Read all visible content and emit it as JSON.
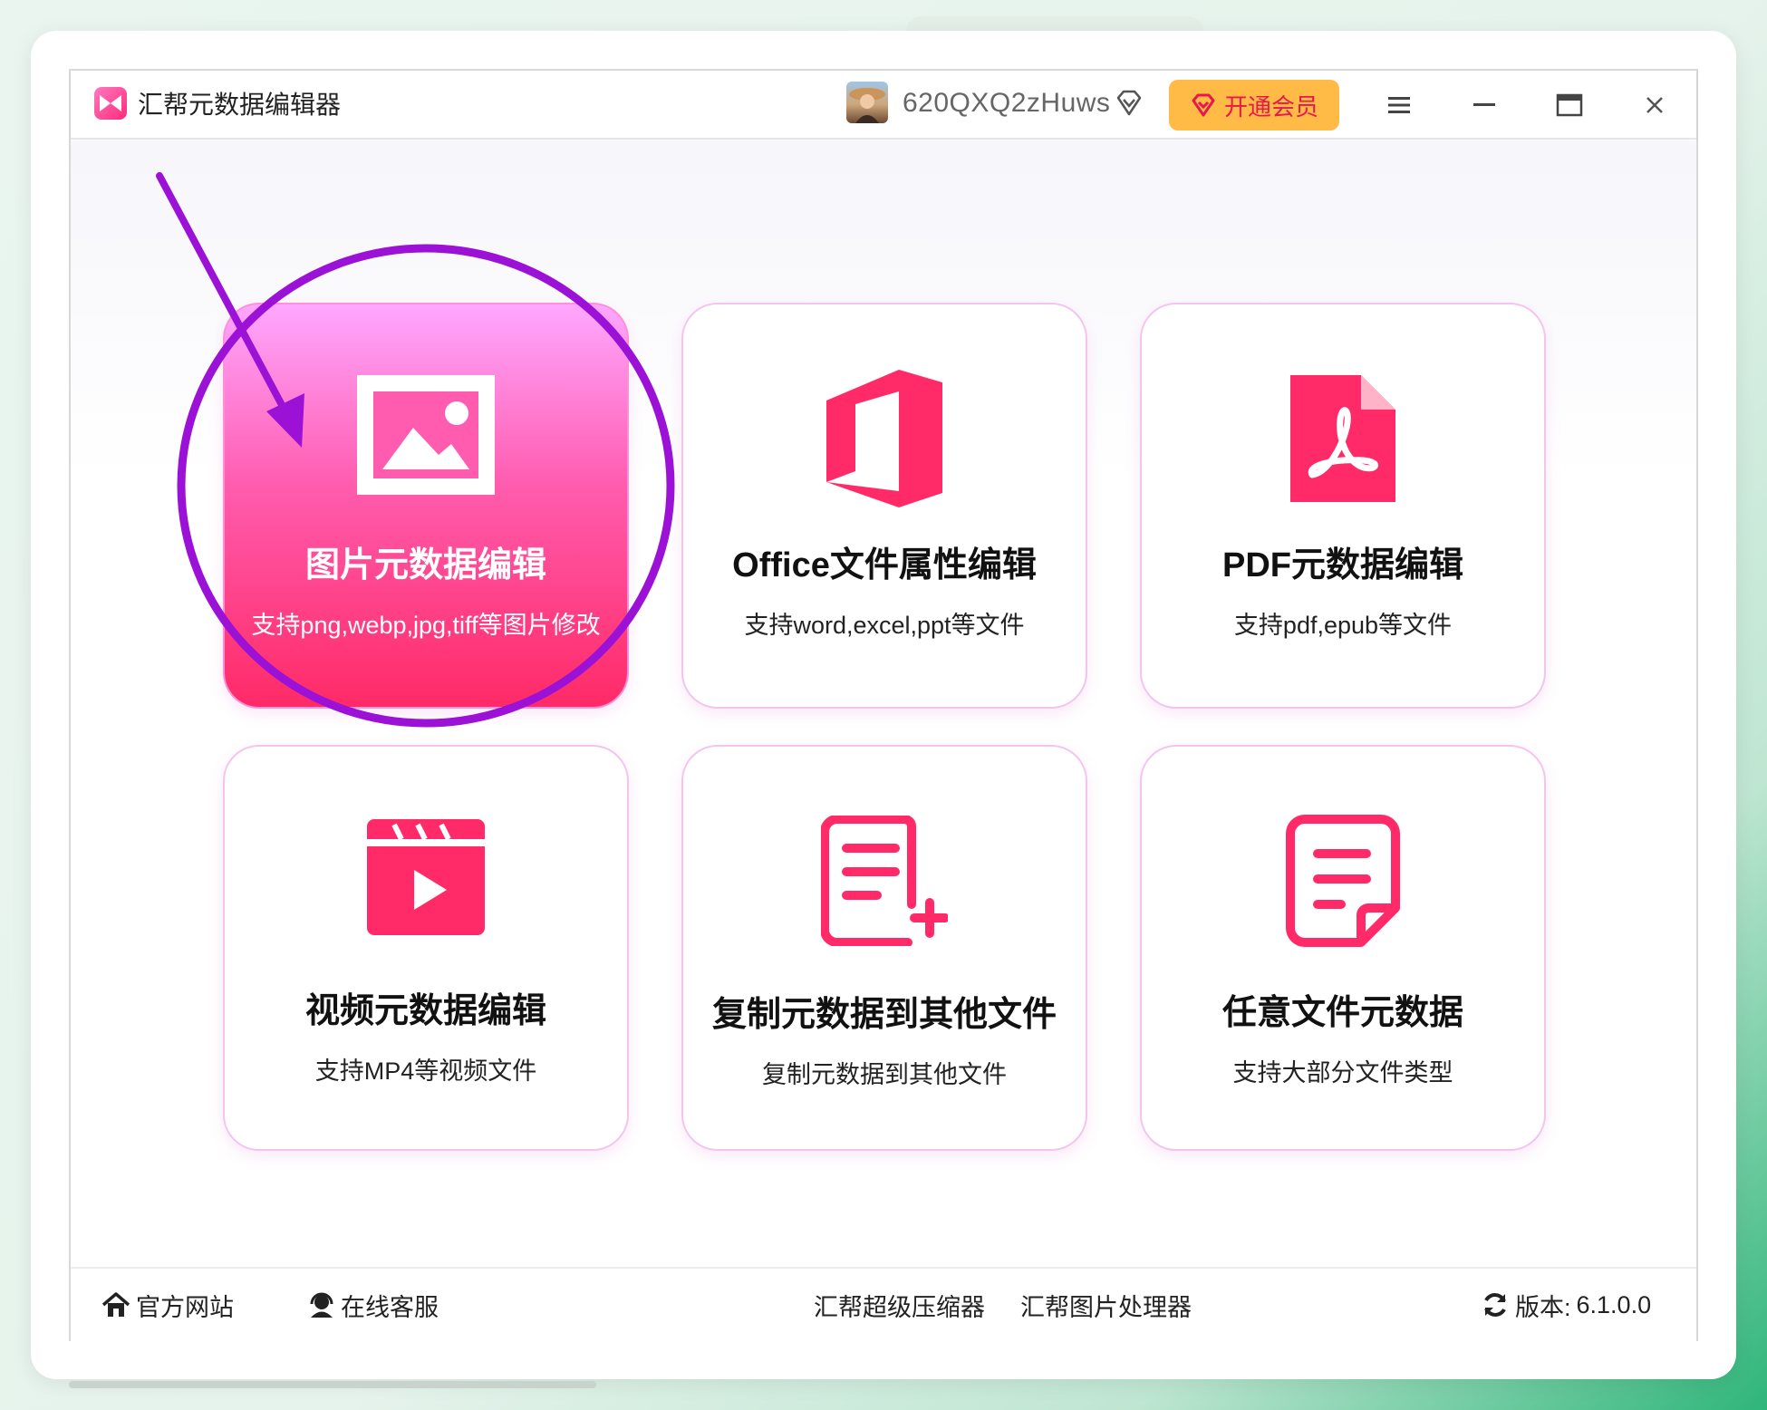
{
  "app": {
    "title": "汇帮元数据编辑器",
    "username": "620QXQ2zHuws",
    "vip_label": "开通会员"
  },
  "cards": [
    {
      "title": "图片元数据编辑",
      "subtitle": "支持png,webp,jpg,tiff等图片修改",
      "icon": "image-icon",
      "active": true
    },
    {
      "title": "Office文件属性编辑",
      "subtitle": "支持word,excel,ppt等文件",
      "icon": "office-icon",
      "active": false
    },
    {
      "title": "PDF元数据编辑",
      "subtitle": "支持pdf,epub等文件",
      "icon": "pdf-icon",
      "active": false
    },
    {
      "title": "视频元数据编辑",
      "subtitle": "支持MP4等视频文件",
      "icon": "video-icon",
      "active": false
    },
    {
      "title": "复制元数据到其他文件",
      "subtitle": "复制元数据到其他文件",
      "icon": "copy-doc-icon",
      "active": false
    },
    {
      "title": "任意文件元数据",
      "subtitle": "支持大部分文件类型",
      "icon": "file-icon",
      "active": false
    }
  ],
  "footer": {
    "official_site": "官方网站",
    "online_support": "在线客服",
    "compressor": "汇帮超级压缩器",
    "image_processor": "汇帮图片处理器",
    "version_label": "版本:",
    "version": "6.1.0.0"
  },
  "colors": {
    "accent": "#ff2a67",
    "vip_bg": "#ffbb46",
    "annotation": "#9b12d6"
  }
}
